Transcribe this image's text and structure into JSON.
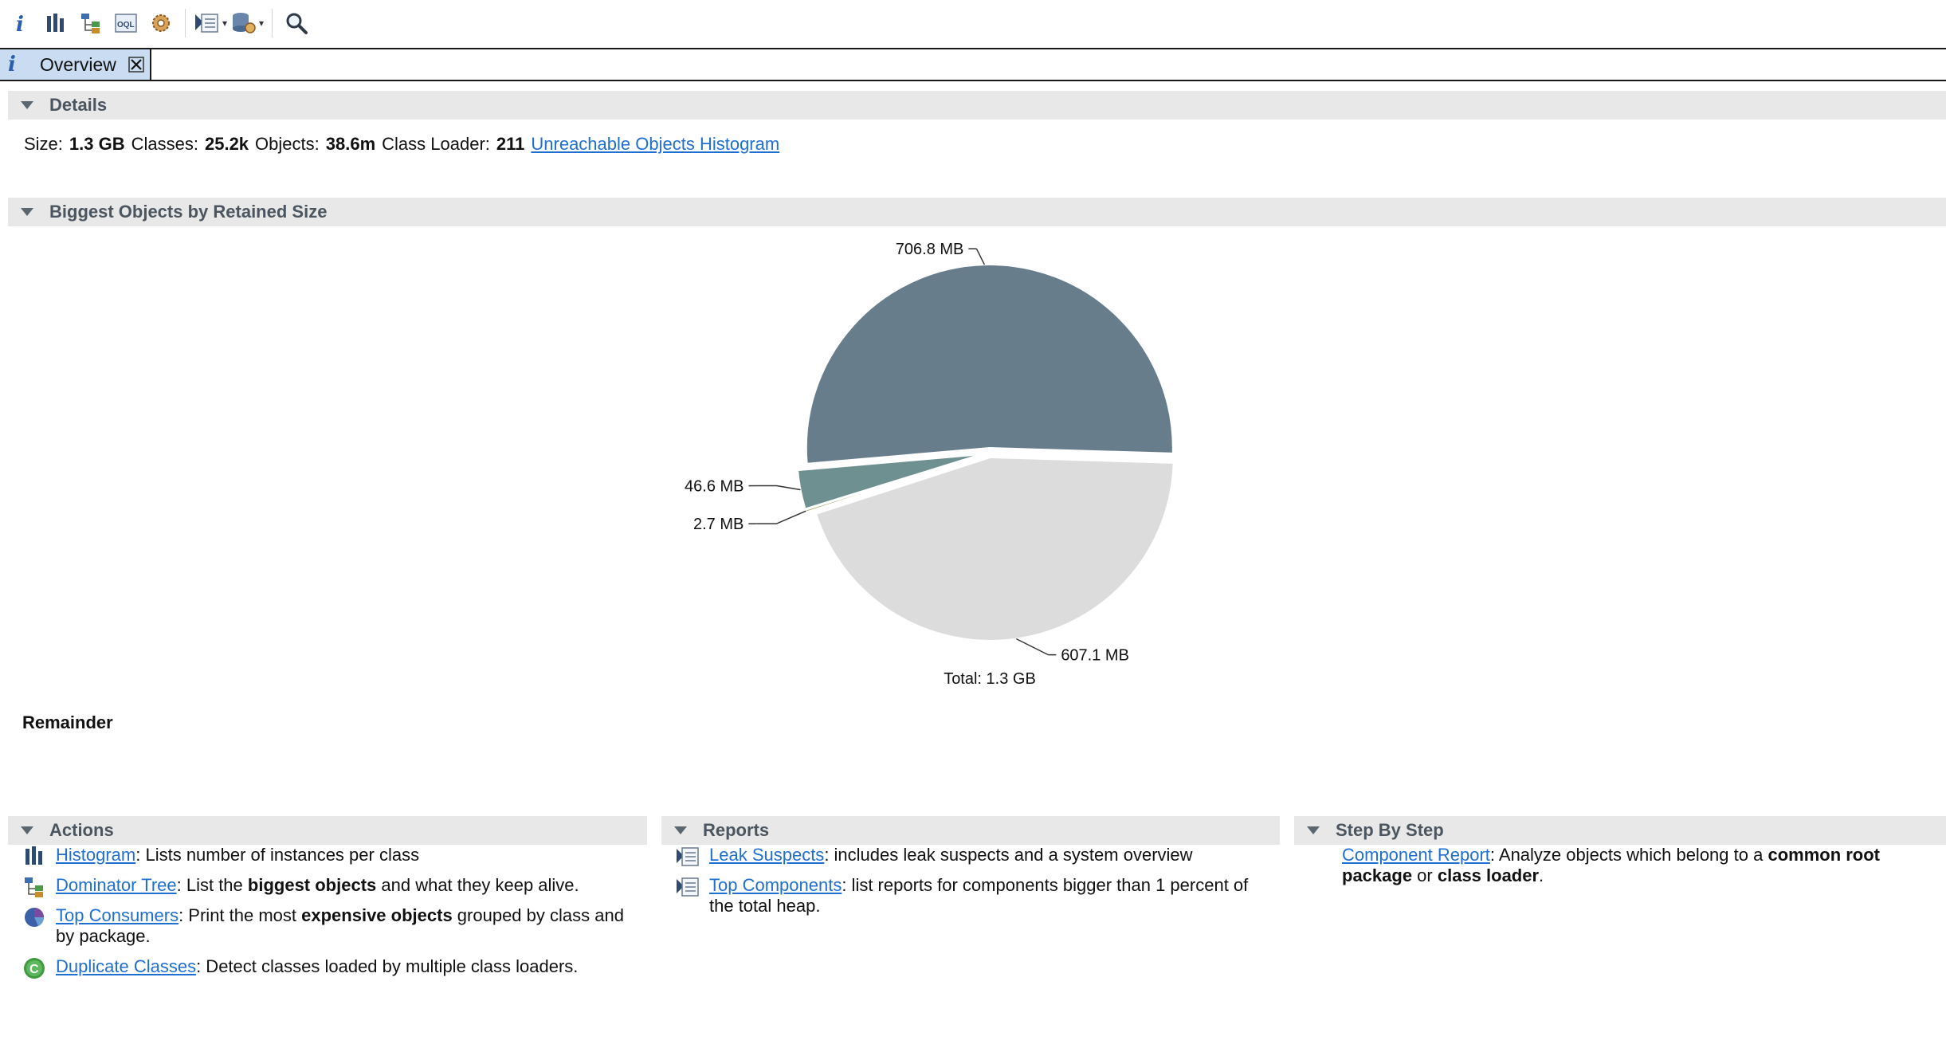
{
  "toolbar": {
    "buttons": [
      {
        "name": "overview-button",
        "icon": "info-icon"
      },
      {
        "name": "histogram-button",
        "icon": "histogram-icon"
      },
      {
        "name": "dominator-tree-button",
        "icon": "dominator-tree-icon"
      },
      {
        "name": "oql-button",
        "icon": "oql-icon"
      },
      {
        "name": "thread-overview-button",
        "icon": "gears-icon"
      },
      {
        "name": "reports-dropdown-button",
        "icon": "report-icon"
      },
      {
        "name": "query-browser-dropdown-button",
        "icon": "database-gear-icon"
      },
      {
        "name": "search-button",
        "icon": "search-icon"
      }
    ]
  },
  "tab": {
    "label": "Overview"
  },
  "details": {
    "header": "Details",
    "size_label": "Size:",
    "size_value": "1.3 GB",
    "classes_label": "Classes:",
    "classes_value": "25.2k",
    "objects_label": "Objects:",
    "objects_value": "38.6m",
    "class_loader_label": "Class Loader:",
    "class_loader_value": "211",
    "histogram_link": "Unreachable Objects Histogram"
  },
  "biggest": {
    "header": "Biggest Objects by Retained Size",
    "remainder_label": "Remainder"
  },
  "chart_data": {
    "type": "pie",
    "slices": [
      {
        "label": "706.8 MB",
        "value": 706.8,
        "color": "#687d8c"
      },
      {
        "label": "46.6 MB",
        "value": 46.6,
        "color": "#6e9090"
      },
      {
        "label": "2.7 MB",
        "value": 2.7,
        "color": "#9aa45a"
      },
      {
        "label": "607.1 MB",
        "value": 607.1,
        "color": "#dcdcdc"
      }
    ],
    "total_label": "Total: 1.3 GB"
  },
  "actions": {
    "header": "Actions",
    "items": [
      {
        "link": "Histogram",
        "pre": ": Lists number of instances per class",
        "bold": "",
        "post": ""
      },
      {
        "link": "Dominator Tree",
        "pre": ": List the ",
        "bold": "biggest objects",
        "post": " and what they keep alive."
      },
      {
        "link": "Top Consumers",
        "pre": ": Print the most ",
        "bold": "expensive objects",
        "post": " grouped by class and by package."
      },
      {
        "link": "Duplicate Classes",
        "pre": ": Detect classes loaded by multiple class loaders.",
        "bold": "",
        "post": ""
      }
    ]
  },
  "reports": {
    "header": "Reports",
    "items": [
      {
        "link": "Leak Suspects",
        "text": ": includes leak suspects and a system overview"
      },
      {
        "link": "Top Components",
        "text": ": list reports for components bigger than 1 percent of the total heap."
      }
    ]
  },
  "stepbystep": {
    "header": "Step By Step",
    "link": "Component Report",
    "pre": ": Analyze objects which belong to a ",
    "bold1": "common root package",
    "mid": " or ",
    "bold2": "class loader",
    "post": "."
  }
}
